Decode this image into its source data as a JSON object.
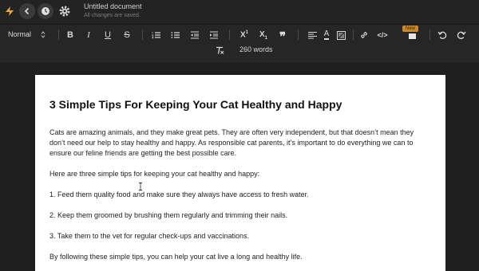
{
  "header": {
    "doc_title": "Untitled document",
    "doc_status": "All changes are saved."
  },
  "toolbar": {
    "style_value": "Normal",
    "new_badge": "New",
    "word_count": "260 words",
    "icons": [
      "bold-icon",
      "italic-icon",
      "underline-icon",
      "strikethrough-icon",
      "numbered-list-icon",
      "bullet-list-icon",
      "outdent-icon",
      "indent-icon",
      "superscript-icon",
      "subscript-icon",
      "quote-icon",
      "align-icon",
      "text-color-icon",
      "highlight-icon",
      "link-icon",
      "code-icon",
      "color-swatch-icon",
      "undo-icon",
      "redo-icon",
      "clear-format-icon"
    ]
  },
  "document": {
    "title": "3 Simple Tips For Keeping Your Cat Healthy and Happy",
    "paragraphs": [
      "Cats are amazing animals, and they make great pets. They are often very independent, but that doesn’t mean they don’t need our help to stay healthy and happy. As responsible cat parents, it’s important to do everything we can to ensure our feline friends are getting the best possible care.",
      "Here are three simple tips for keeping your cat healthy and happy:",
      "1. Feed them quality food and make sure they always have access to fresh water.",
      "2. Keep them groomed by brushing them regularly and trimming their nails.",
      "3. Take them to the vet for regular check-ups and vaccinations.",
      "By following these simple tips, you can help your cat live a long and healthy life."
    ]
  },
  "colors": {
    "background": "#1f1f1f",
    "toolbar": "#262626",
    "page": "#ffffff",
    "accent": "#f2a93b",
    "badge": "#c9862b"
  }
}
